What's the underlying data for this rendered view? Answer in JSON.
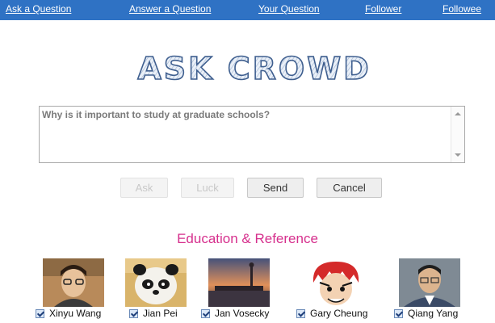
{
  "nav": {
    "items": [
      {
        "label": "Ask a Question"
      },
      {
        "label": "Answer a Question"
      },
      {
        "label": "Your Question"
      },
      {
        "label": "Follower"
      },
      {
        "label": "Followee"
      }
    ],
    "color": "#2f72c4"
  },
  "logo": {
    "text": "ASK CROWD"
  },
  "question": {
    "value": "Why is it important to study at graduate schools?"
  },
  "buttons": {
    "ask": "Ask",
    "luck": "Luck",
    "send": "Send",
    "cancel": "Cancel"
  },
  "section": {
    "title": "Education & Reference",
    "color": "#d6308d"
  },
  "people": [
    {
      "name": "Xinyu Wang",
      "checked": true
    },
    {
      "name": "Jian Pei",
      "checked": true
    },
    {
      "name": "Jan Vosecky",
      "checked": true
    },
    {
      "name": "Gary Cheung",
      "checked": true
    },
    {
      "name": "Qiang Yang",
      "checked": true
    }
  ]
}
